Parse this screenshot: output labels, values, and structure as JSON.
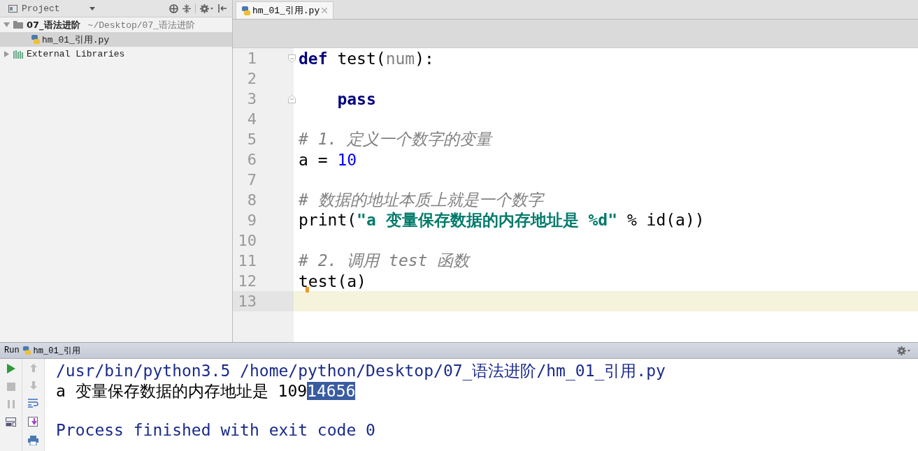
{
  "project_panel": {
    "title": "Project",
    "tree": [
      {
        "label": "07_语法进阶",
        "path": "~/Desktop/07_语法进阶",
        "kind": "folder",
        "expanded": true,
        "selected": false,
        "children": [
          {
            "label": "hm_01_引用.py",
            "kind": "python-file",
            "selected": true
          }
        ]
      },
      {
        "label": "External Libraries",
        "kind": "library",
        "expanded": false,
        "selected": false
      }
    ]
  },
  "editor": {
    "tabs": [
      {
        "label": "hm_01_引用.py",
        "selected": true
      }
    ],
    "lines": [
      {
        "number": "1",
        "current": false,
        "fold_start": true,
        "tokens": [
          {
            "text": "def",
            "kind": "keyword"
          },
          {
            "text": " test(",
            "kind": "plain"
          },
          {
            "text": "num",
            "kind": "param"
          },
          {
            "text": "):",
            "kind": "plain"
          }
        ]
      },
      {
        "number": "2",
        "current": false
      },
      {
        "number": "3",
        "current": false,
        "fold_end": true,
        "tokens": [
          {
            "text": "    pass",
            "kind": "keyword"
          }
        ]
      },
      {
        "number": "4",
        "current": false
      },
      {
        "number": "5",
        "current": false,
        "tokens": [
          {
            "text": "# 1. 定义一个数字的变量",
            "kind": "comment"
          }
        ]
      },
      {
        "number": "6",
        "current": false,
        "tokens": [
          {
            "text": "a = ",
            "kind": "plain"
          },
          {
            "text": "10",
            "kind": "number"
          }
        ]
      },
      {
        "number": "7",
        "current": false
      },
      {
        "number": "8",
        "current": false,
        "tokens": [
          {
            "text": "# 数据的地址本质上就是一个数字",
            "kind": "comment"
          }
        ]
      },
      {
        "number": "9",
        "current": false,
        "tokens": [
          {
            "text": "print(",
            "kind": "plain"
          },
          {
            "text": "\"a 变量保存数据的内存地址是 %d\"",
            "kind": "string"
          },
          {
            "text": " % id(a))",
            "kind": "plain"
          }
        ]
      },
      {
        "number": "10",
        "current": false
      },
      {
        "number": "11",
        "current": false,
        "tokens": [
          {
            "text": "# 2. 调用 test 函数",
            "kind": "comment"
          }
        ]
      },
      {
        "number": "12",
        "current": false,
        "marker": true,
        "tokens": [
          {
            "text": "test(a)",
            "kind": "plain"
          }
        ]
      },
      {
        "number": "13",
        "current": true
      }
    ]
  },
  "run_panel": {
    "title": "Run",
    "config": "hm_01_引用",
    "output": [
      {
        "segments": [
          {
            "text": "/usr/bin/python3.5 /home/python/Desktop/07_语法进阶/hm_01_引用.py",
            "kind": "system",
            "selected": false
          }
        ]
      },
      {
        "segments": [
          {
            "text": "a 变量保存数据的内存地址是 109",
            "kind": "stdout",
            "selected": false
          },
          {
            "text": "14656",
            "kind": "stdout",
            "selected": true
          }
        ]
      },
      {
        "blank": true
      },
      {
        "segments": [
          {
            "text": "Process finished with exit code 0",
            "kind": "system",
            "selected": false
          }
        ]
      }
    ]
  }
}
